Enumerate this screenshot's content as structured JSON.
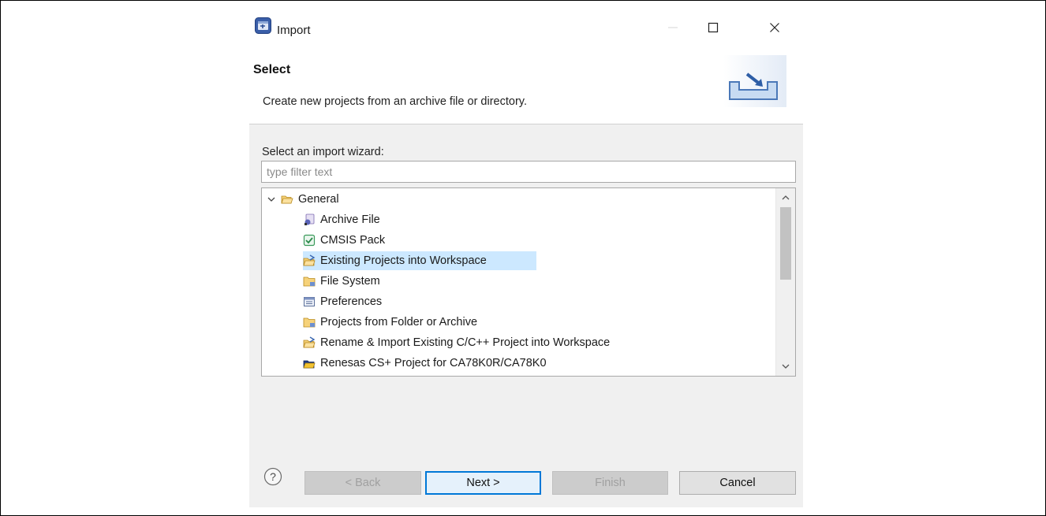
{
  "window": {
    "title": "Import",
    "icons": {
      "app": "eclipse-import-icon",
      "minimize": "minimize-icon",
      "maximize": "maximize-icon",
      "close": "close-icon"
    }
  },
  "banner": {
    "title": "Select",
    "description": "Create new projects from an archive file or directory.",
    "icon": "import-tray-icon"
  },
  "wizard": {
    "label": "Select an import wizard:",
    "filter_placeholder": "type filter text",
    "filter_value": ""
  },
  "tree": {
    "root": {
      "label": "General",
      "icon": "folder-open-icon",
      "expanded": true
    },
    "items": [
      {
        "label": "Archive File",
        "icon": "archive-file-icon",
        "selected": false
      },
      {
        "label": "CMSIS Pack",
        "icon": "checkbox-pack-icon",
        "selected": false
      },
      {
        "label": "Existing Projects into Workspace",
        "icon": "project-folder-icon",
        "selected": true
      },
      {
        "label": "File System",
        "icon": "folder-icon",
        "selected": false
      },
      {
        "label": "Preferences",
        "icon": "preferences-icon",
        "selected": false
      },
      {
        "label": "Projects from Folder or Archive",
        "icon": "folder-icon",
        "selected": false
      },
      {
        "label": "Rename & Import Existing C/C++ Project into Workspace",
        "icon": "project-folder-icon",
        "selected": false
      },
      {
        "label": "Renesas CS+ Project for CA78K0R/CA78K0",
        "icon": "renesas-project-icon",
        "selected": false
      }
    ]
  },
  "buttons": {
    "back": "< Back",
    "next": "Next >",
    "finish": "Finish",
    "cancel": "Cancel",
    "help_icon": "help-icon"
  },
  "colors": {
    "selection": "#cce8ff",
    "primary_border": "#0078d7",
    "dialog_bg": "#f0f0f0"
  }
}
